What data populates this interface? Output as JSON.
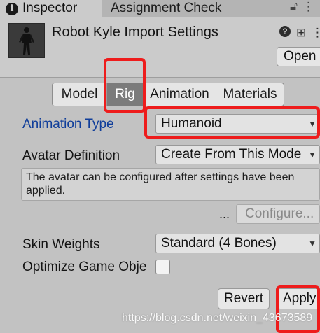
{
  "tabs": {
    "inspector_label": "Inspector",
    "assignment_check_label": "Assignment Check"
  },
  "header": {
    "title": "Robot Kyle Import Settings",
    "open_label": "Open",
    "icons": [
      "help-icon",
      "presets-icon",
      "more-icon",
      "lock-icon",
      "menu-icon",
      "info-icon"
    ]
  },
  "importer_tabs": {
    "items": [
      "Model",
      "Rig",
      "Animation",
      "Materials"
    ],
    "selected": "Rig"
  },
  "rig": {
    "animation_type_label": "Animation Type",
    "animation_type_value": "Humanoid",
    "avatar_definition_label": "Avatar Definition",
    "avatar_definition_value": "Create From This Mode",
    "help_text": "The avatar can be configured after settings have been applied.",
    "ellipsis": "...",
    "configure_label": "Configure...",
    "skin_weights_label": "Skin Weights",
    "skin_weights_value": "Standard (4 Bones)",
    "optimize_label": "Optimize Game Obje",
    "optimize_checked": false
  },
  "footer": {
    "revert_label": "Revert",
    "apply_label": "Apply"
  },
  "watermark": "https://blog.csdn.net/weixin_43673589",
  "colors": {
    "highlight": "#ee1c1c",
    "label_blue": "#103e9a",
    "selected_tab": "#7b7b7b"
  }
}
